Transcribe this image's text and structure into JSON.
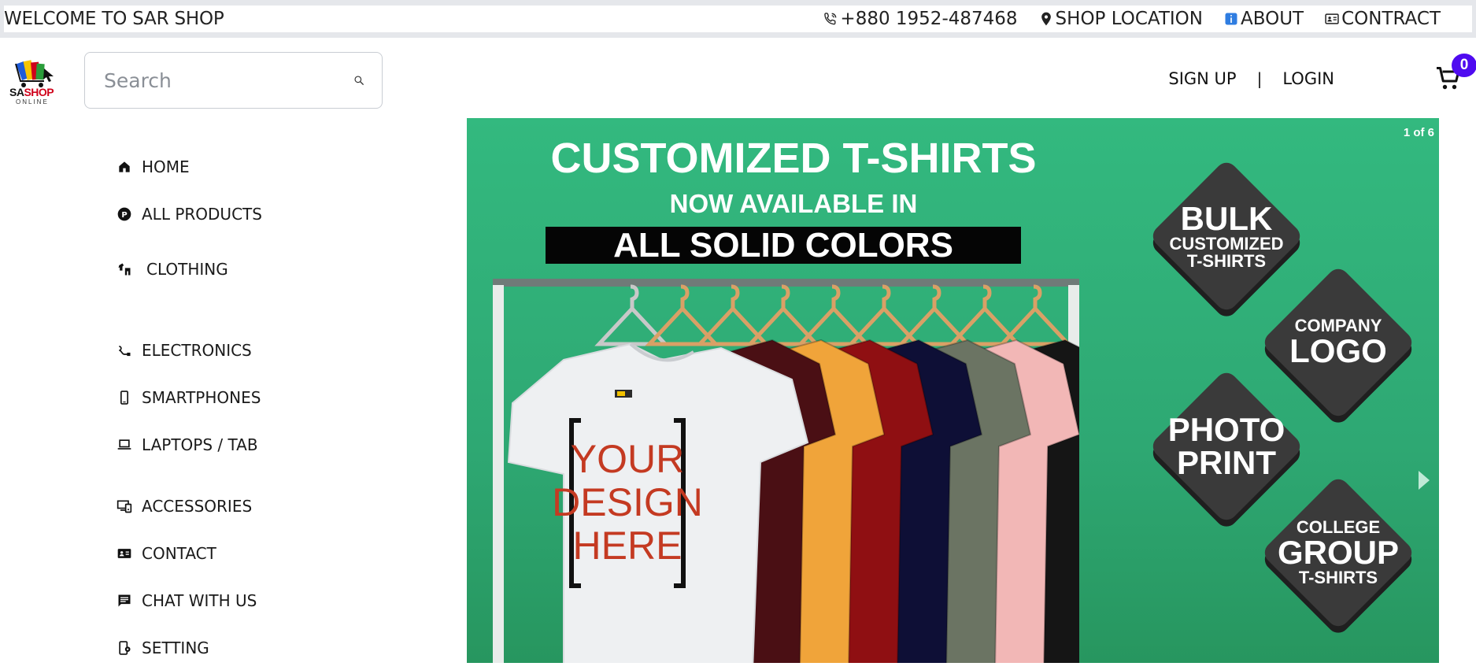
{
  "topbar": {
    "welcome": "WELCOME TO SAR SHOP",
    "phone": "+880 1952-487468",
    "shop_location": "SHOP LOCATION",
    "about": "ABOUT",
    "contract": "CONTRACT"
  },
  "header": {
    "logo_sa": "SA",
    "logo_shop": "SHOP",
    "logo_sub": "ONLINE",
    "search_placeholder": "Search",
    "sign_up": "SIGN UP",
    "separator": "|",
    "login": "LOGIN",
    "cart_count": "0"
  },
  "sidebar": {
    "items": [
      {
        "label": "HOME",
        "icon": "home-icon"
      },
      {
        "label": "ALL PRODUCTS",
        "icon": "products-icon"
      },
      {
        "label": "CLOTHING",
        "icon": "clothing-icon"
      },
      {
        "label": "ELECTRONICS",
        "icon": "electronics-icon"
      },
      {
        "label": "SMARTPHONES",
        "icon": "smartphone-icon"
      },
      {
        "label": "LAPTOPS / TAB",
        "icon": "laptop-icon"
      },
      {
        "label": "ACCESSORIES",
        "icon": "accessories-icon"
      },
      {
        "label": "CONTACT",
        "icon": "contact-card-icon"
      },
      {
        "label": "CHAT WITH US",
        "icon": "chat-icon"
      },
      {
        "label": "SETTING",
        "icon": "setting-icon"
      }
    ]
  },
  "hero": {
    "counter": "1 of 6",
    "line1": "CUSTOMIZED T-SHIRTS",
    "line2": "NOW AVAILABLE IN",
    "band": "ALL SOLID COLORS",
    "design_text": [
      "YOUR",
      "DESIGN",
      "HERE"
    ],
    "badges": [
      {
        "big": "BULK",
        "small1": "CUSTOMIZED",
        "small2": "T-SHIRTS"
      },
      {
        "small1": "COMPANY",
        "big": "LOGO"
      },
      {
        "big1": "PHOTO",
        "big2": "PRINT"
      },
      {
        "small1": "COLLEGE",
        "big": "GROUP",
        "small2": "T-SHIRTS"
      }
    ],
    "shirt_colors": [
      "#4a0f14",
      "#f0a43a",
      "#8f0f12",
      "#0e0f36",
      "#6b7463",
      "#f2b7b6",
      "#151515"
    ],
    "bg_color": "#33b97f"
  },
  "colors": {
    "badge": "#4f0bf0",
    "text": "#1a1a1a"
  }
}
